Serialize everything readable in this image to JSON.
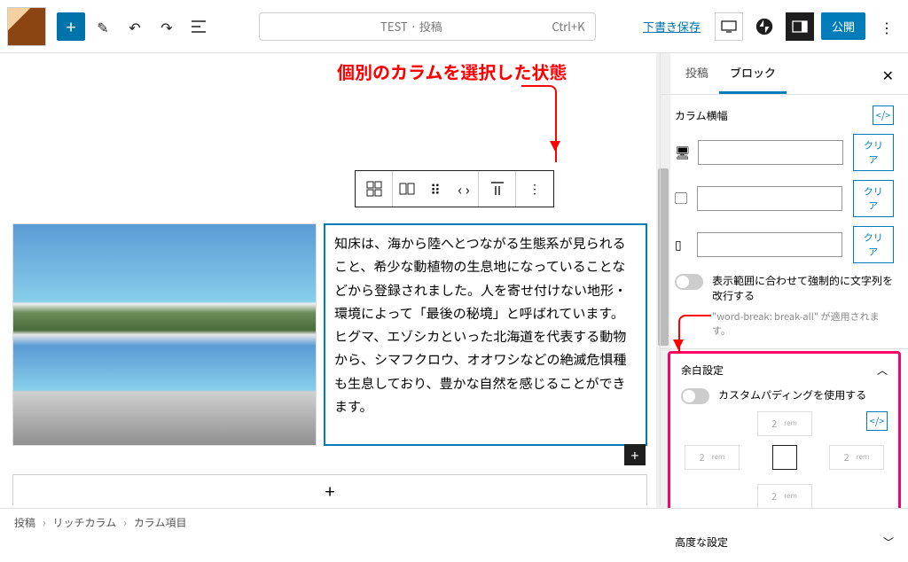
{
  "topbar": {
    "title": "TEST · 投稿",
    "shortcut": "Ctrl+K",
    "save_draft": "下書き保存",
    "publish": "公開"
  },
  "annotation": "個別のカラムを選択した状態",
  "column_text": "知床は、海から陸へとつながる生態系が見られること、希少な動植物の生息地になっていることなどから登録されました。人を寄せ付けない地形・環境によって「最後の秘境」と呼ばれています。ヒグマ、エゾシカといった北海道を代表する動物から、シマフクロウ、オオワシなどの絶滅危惧種も生息しており、豊かな自然を感じることができます。",
  "sidebar": {
    "tabs": {
      "post": "投稿",
      "block": "ブロック"
    },
    "width_section": {
      "title": "カラム横幅",
      "unit": "%",
      "clear": "クリア"
    },
    "break_toggle": {
      "label": "表示範囲に合わせて強制的に文字列を改行する",
      "help": "\"word-break: break-all\" が適用されます。"
    },
    "margin_section": {
      "title": "余白設定",
      "custom_padding": "カスタムパディングを使用する",
      "value": "2",
      "unit": "rem"
    },
    "advanced": "高度な設定"
  },
  "breadcrumb": {
    "l1": "投稿",
    "l2": "リッチカラム",
    "l3": "カラム項目"
  }
}
